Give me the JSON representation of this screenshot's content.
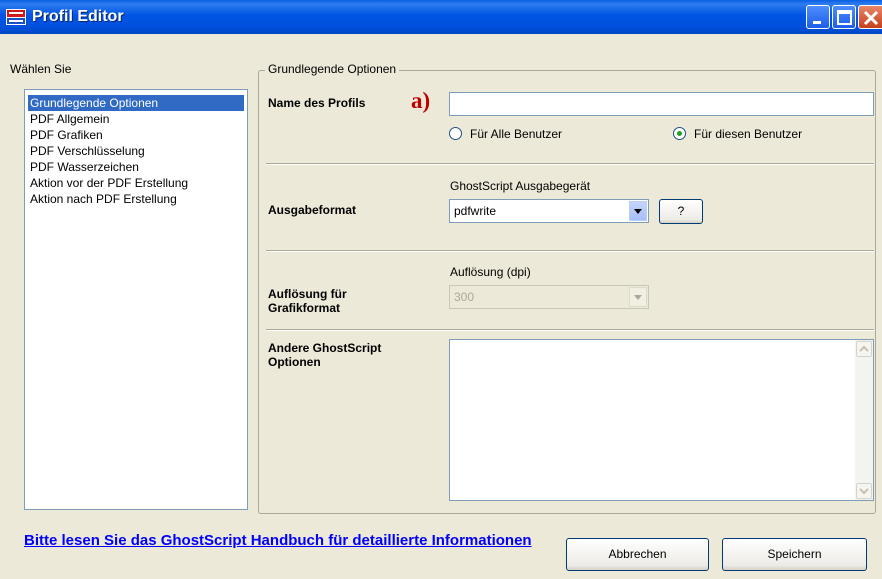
{
  "window": {
    "title": "Profil Editor",
    "icon": "pdf-printer-icon"
  },
  "left_panel": {
    "label": "Wählen Sie",
    "items": [
      "Grundlegende Optionen",
      "PDF Allgemein",
      "PDF Grafiken",
      "PDF Verschlüsselung",
      "PDF Wasserzeichen",
      "Aktion vor der PDF Erstellung",
      "Aktion nach PDF Erstellung"
    ],
    "selected_index": 0
  },
  "group": {
    "legend": "Grundlegende Optionen",
    "profile_name_label": "Name des Profils",
    "marker": "a)",
    "profile_name_value": "",
    "radio_all_users": "Für Alle Benutzer",
    "radio_this_user": "Für diesen Benutzer",
    "radio_selected": "this_user",
    "output_format_label": "Ausgabeformat",
    "device_label": "GhostScript Ausgabegerät",
    "device_value": "pdfwrite",
    "help_button": "?",
    "resolution_label": "Auflösung für Grafikformat",
    "resolution_dpi_label": "Auflösung (dpi)",
    "resolution_value": "300",
    "other_options_label": "Andere GhostScript Optionen",
    "other_options_value": ""
  },
  "footer": {
    "help_link": "Bitte lesen Sie das GhostScript Handbuch für detaillierte Informationen",
    "cancel_button": "Abbrechen",
    "save_button": "Speichern"
  },
  "colors": {
    "titlebar": "#0054e3",
    "selection": "#316ac5",
    "link": "#0000ff",
    "marker": "#c00000",
    "dialog_bg": "#ece9d8"
  }
}
